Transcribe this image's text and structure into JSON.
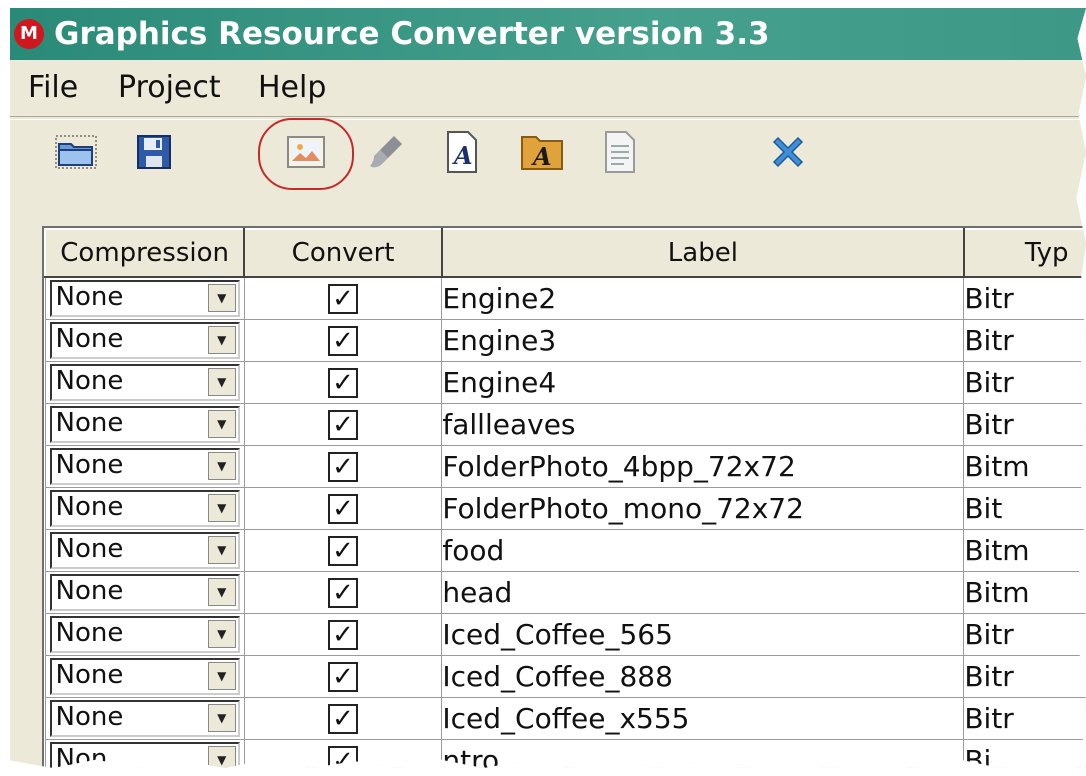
{
  "window": {
    "title": "Graphics Resource Converter version 3.3",
    "logo_glyph": "M"
  },
  "menu": {
    "items": [
      "File",
      "Project",
      "Help"
    ]
  },
  "toolbar": {
    "icons": [
      "open-folder-icon",
      "save-disk-icon",
      "add-image-icon",
      "brush-icon",
      "add-font-icon",
      "font-folder-icon",
      "document-icon",
      "delete-x-icon"
    ],
    "highlight_color": "#c42a2a"
  },
  "grid": {
    "columns": [
      "Compression",
      "Convert",
      "Label",
      "Typ"
    ],
    "rows": [
      {
        "compression": "None",
        "convert": "✓",
        "label": "Engine2",
        "type": "Bitr"
      },
      {
        "compression": "None",
        "convert": "✓",
        "label": "Engine3",
        "type": "Bitr"
      },
      {
        "compression": "None",
        "convert": "✓",
        "label": "Engine4",
        "type": "Bitr"
      },
      {
        "compression": "None",
        "convert": "✓",
        "label": "fallleaves",
        "type": "Bitr"
      },
      {
        "compression": "None",
        "convert": "✓",
        "label": "FolderPhoto_4bpp_72x72",
        "type": "Bitm"
      },
      {
        "compression": "None",
        "convert": "✓",
        "label": "FolderPhoto_mono_72x72",
        "type": "Bit"
      },
      {
        "compression": "None",
        "convert": "✓",
        "label": "food",
        "type": "Bitm"
      },
      {
        "compression": "None",
        "convert": "✓",
        "label": "head",
        "type": "Bitm"
      },
      {
        "compression": "None",
        "convert": "✓",
        "label": "Iced_Coffee_565",
        "type": "Bitr"
      },
      {
        "compression": "None",
        "convert": "✓",
        "label": "Iced_Coffee_888",
        "type": "Bitr"
      },
      {
        "compression": "None",
        "convert": "✓",
        "label": "Iced_Coffee_x555",
        "type": "Bitr"
      },
      {
        "compression": "Non",
        "convert": "✓",
        "label": "ntro",
        "type": "Bi"
      }
    ],
    "dropdown_arrow": "▼"
  }
}
